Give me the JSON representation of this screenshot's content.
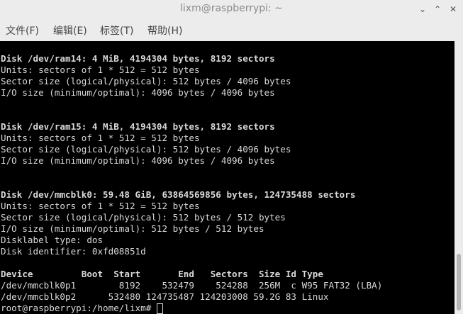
{
  "window": {
    "title": "lixm@raspberrypi: ~",
    "minimize_glyph": "⌄",
    "maximize_glyph": "⌃",
    "close_glyph": "✕"
  },
  "menu": {
    "items": [
      "文件(F)",
      "编辑(E)",
      "标签(T)",
      "帮助(H)"
    ]
  },
  "terminal": {
    "lines": [
      {
        "text": "Disk /dev/ram14: 4 MiB, 4194304 bytes, 8192 sectors",
        "bold": true
      },
      {
        "text": "Units: sectors of 1 * 512 = 512 bytes",
        "bold": false
      },
      {
        "text": "Sector size (logical/physical): 512 bytes / 4096 bytes",
        "bold": false
      },
      {
        "text": "I/O size (minimum/optimal): 4096 bytes / 4096 bytes",
        "bold": false
      },
      {
        "text": "",
        "bold": false
      },
      {
        "text": "",
        "bold": false
      },
      {
        "text": "Disk /dev/ram15: 4 MiB, 4194304 bytes, 8192 sectors",
        "bold": true
      },
      {
        "text": "Units: sectors of 1 * 512 = 512 bytes",
        "bold": false
      },
      {
        "text": "Sector size (logical/physical): 512 bytes / 4096 bytes",
        "bold": false
      },
      {
        "text": "I/O size (minimum/optimal): 4096 bytes / 4096 bytes",
        "bold": false
      },
      {
        "text": "",
        "bold": false
      },
      {
        "text": "",
        "bold": false
      },
      {
        "text": "Disk /dev/mmcblk0: 59.48 GiB, 63864569856 bytes, 124735488 sectors",
        "bold": true
      },
      {
        "text": "Units: sectors of 1 * 512 = 512 bytes",
        "bold": false
      },
      {
        "text": "Sector size (logical/physical): 512 bytes / 512 bytes",
        "bold": false
      },
      {
        "text": "I/O size (minimum/optimal): 512 bytes / 512 bytes",
        "bold": false
      },
      {
        "text": "Disklabel type: dos",
        "bold": false
      },
      {
        "text": "Disk identifier: 0xfd08851d",
        "bold": false
      },
      {
        "text": "",
        "bold": false
      },
      {
        "text": "Device         Boot  Start       End   Sectors  Size Id Type",
        "bold": true
      },
      {
        "text": "/dev/mmcblk0p1        8192    532479    524288  256M  c W95 FAT32 (LBA)",
        "bold": false
      },
      {
        "text": "/dev/mmcblk0p2      532480 124735487 124203008 59.2G 83 Linux",
        "bold": false
      },
      {
        "text": "root@raspberrypi:/home/lixm# ",
        "bold": false
      }
    ]
  }
}
